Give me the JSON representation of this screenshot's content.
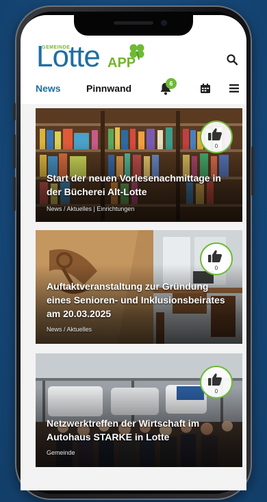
{
  "app": {
    "logo_small": "GEMEINDE",
    "logo_main": "Lotte",
    "logo_app": "APP"
  },
  "nav": {
    "tabs": [
      "News",
      "Pinnwand"
    ],
    "notification_count": "6",
    "icons": [
      "bell-icon",
      "calendar-icon",
      "menu-icon",
      "search-icon"
    ]
  },
  "colors": {
    "brand_blue": "#1d6fa3",
    "brand_green": "#6dbb35",
    "background": "#17497a"
  },
  "articles": [
    {
      "title": "Start der neuen Vorlesenachmittage in der Bücherei Alt-Lotte",
      "category": "News / Aktuelles | Einrichtungen",
      "likes": "0"
    },
    {
      "title": "Auftaktveranstaltung zur Gründung eines Senioren- und Inklusionsbeirates am 20.03.2025",
      "category": "News / Aktuelles",
      "likes": "0"
    },
    {
      "title": "Netzwerktreffen der Wirtschaft im Autohaus STARKE in Lotte",
      "category": "Gemeinde",
      "likes": "0"
    }
  ]
}
